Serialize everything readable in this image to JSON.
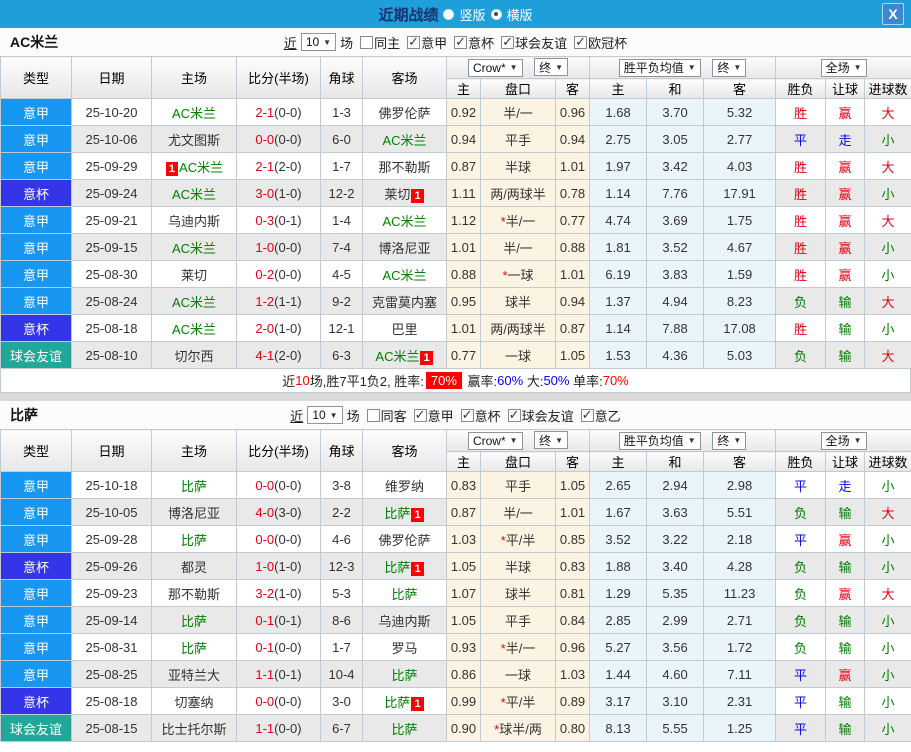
{
  "titlebar": {
    "title": "近期战绩",
    "layout_options": [
      {
        "label": "竖版",
        "selected": false
      },
      {
        "label": "横版",
        "selected": true
      }
    ],
    "close_label": "X"
  },
  "table": {
    "columns": [
      "类型",
      "日期",
      "主场",
      "比分(半场)",
      "角球",
      "客场"
    ],
    "odds_group": {
      "select1": "Crow*",
      "select2": "终",
      "sub": [
        "主",
        "盘口",
        "客"
      ]
    },
    "avg_group": {
      "select1": "胜平负均值",
      "select2": "终",
      "sub": [
        "主",
        "和",
        "客"
      ]
    },
    "result_group": {
      "select1": "全场",
      "sub": [
        "胜负",
        "让球",
        "进球数"
      ]
    }
  },
  "colors": {
    "titlebar_bg": "#1E9FD9",
    "title_text": "#15336E",
    "close_bg": "#3E86D2",
    "focal_team": "#008000",
    "score_red": "#E60012",
    "badge_bg": "#FF0000",
    "stripe": "#E9E9E9",
    "cream": "#FCF4E3",
    "light_blue": "#EAF5FB",
    "border": "#C3CBD2",
    "gap": "#DADADA",
    "stat_blue": "#0000FF",
    "stat_red": "#FF0000",
    "league": {
      "意甲": "#1897F2",
      "意杯": "#3434E8",
      "球会友谊": "#21A89B"
    },
    "result": {
      "胜": "#E60012",
      "平": "#0808E0",
      "负": "#007A00",
      "赢": "#E60012",
      "走": "#0808E0",
      "输": "#007A00",
      "大": "#E60012",
      "小": "#007A00"
    }
  },
  "sections": [
    {
      "team": "AC米兰",
      "filters": {
        "recent_label": "近",
        "count": "10",
        "unit": "场",
        "same_label": "同主",
        "same_checked": false,
        "leagues": [
          {
            "label": "意甲",
            "checked": true
          },
          {
            "label": "意杯",
            "checked": true
          },
          {
            "label": "球会友谊",
            "checked": true
          },
          {
            "label": "欧冠杯",
            "checked": true
          }
        ]
      },
      "rows": [
        {
          "type": "意甲",
          "date": "25-10-20",
          "home": "AC米兰",
          "home_focal": true,
          "home_badge": "",
          "home_badge_pos": "",
          "score": "2-1",
          "half": "(0-0)",
          "corner": "1-3",
          "away": "佛罗伦萨",
          "away_focal": false,
          "away_badge": "",
          "odds_home": "0.92",
          "handicap_star": false,
          "handicap": "半/一",
          "odds_away": "0.96",
          "avg_home": "1.68",
          "avg_draw": "3.70",
          "avg_away": "5.32",
          "res_wdl": "胜",
          "res_handicap": "赢",
          "res_goals": "大"
        },
        {
          "type": "意甲",
          "date": "25-10-06",
          "home": "尤文图斯",
          "home_focal": false,
          "home_badge": "",
          "home_badge_pos": "",
          "score": "0-0",
          "half": "(0-0)",
          "corner": "6-0",
          "away": "AC米兰",
          "away_focal": true,
          "away_badge": "",
          "odds_home": "0.94",
          "handicap_star": false,
          "handicap": "平手",
          "odds_away": "0.94",
          "avg_home": "2.75",
          "avg_draw": "3.05",
          "avg_away": "2.77",
          "res_wdl": "平",
          "res_handicap": "走",
          "res_goals": "小"
        },
        {
          "type": "意甲",
          "date": "25-09-29",
          "home": "AC米兰",
          "home_focal": true,
          "home_badge": "1",
          "home_badge_pos": "left",
          "score": "2-1",
          "half": "(2-0)",
          "corner": "1-7",
          "away": "那不勒斯",
          "away_focal": false,
          "away_badge": "",
          "odds_home": "0.87",
          "handicap_star": false,
          "handicap": "半球",
          "odds_away": "1.01",
          "avg_home": "1.97",
          "avg_draw": "3.42",
          "avg_away": "4.03",
          "res_wdl": "胜",
          "res_handicap": "赢",
          "res_goals": "大"
        },
        {
          "type": "意杯",
          "date": "25-09-24",
          "home": "AC米兰",
          "home_focal": true,
          "home_badge": "",
          "home_badge_pos": "",
          "score": "3-0",
          "half": "(1-0)",
          "corner": "12-2",
          "away": "莱切",
          "away_focal": false,
          "away_badge": "1",
          "odds_home": "1.11",
          "handicap_star": false,
          "handicap": "两/两球半",
          "odds_away": "0.78",
          "avg_home": "1.14",
          "avg_draw": "7.76",
          "avg_away": "17.91",
          "res_wdl": "胜",
          "res_handicap": "赢",
          "res_goals": "小"
        },
        {
          "type": "意甲",
          "date": "25-09-21",
          "home": "乌迪内斯",
          "home_focal": false,
          "home_badge": "",
          "home_badge_pos": "",
          "score": "0-3",
          "half": "(0-1)",
          "corner": "1-4",
          "away": "AC米兰",
          "away_focal": true,
          "away_badge": "",
          "odds_home": "1.12",
          "handicap_star": true,
          "handicap": "半/一",
          "odds_away": "0.77",
          "avg_home": "4.74",
          "avg_draw": "3.69",
          "avg_away": "1.75",
          "res_wdl": "胜",
          "res_handicap": "赢",
          "res_goals": "大"
        },
        {
          "type": "意甲",
          "date": "25-09-15",
          "home": "AC米兰",
          "home_focal": true,
          "home_badge": "",
          "home_badge_pos": "",
          "score": "1-0",
          "half": "(0-0)",
          "corner": "7-4",
          "away": "博洛尼亚",
          "away_focal": false,
          "away_badge": "",
          "odds_home": "1.01",
          "handicap_star": false,
          "handicap": "半/一",
          "odds_away": "0.88",
          "avg_home": "1.81",
          "avg_draw": "3.52",
          "avg_away": "4.67",
          "res_wdl": "胜",
          "res_handicap": "赢",
          "res_goals": "小"
        },
        {
          "type": "意甲",
          "date": "25-08-30",
          "home": "莱切",
          "home_focal": false,
          "home_badge": "",
          "home_badge_pos": "",
          "score": "0-2",
          "half": "(0-0)",
          "corner": "4-5",
          "away": "AC米兰",
          "away_focal": true,
          "away_badge": "",
          "odds_home": "0.88",
          "handicap_star": true,
          "handicap": "一球",
          "odds_away": "1.01",
          "avg_home": "6.19",
          "avg_draw": "3.83",
          "avg_away": "1.59",
          "res_wdl": "胜",
          "res_handicap": "赢",
          "res_goals": "小"
        },
        {
          "type": "意甲",
          "date": "25-08-24",
          "home": "AC米兰",
          "home_focal": true,
          "home_badge": "",
          "home_badge_pos": "",
          "score": "1-2",
          "half": "(1-1)",
          "corner": "9-2",
          "away": "克雷莫内塞",
          "away_focal": false,
          "away_badge": "",
          "odds_home": "0.95",
          "handicap_star": false,
          "handicap": "球半",
          "odds_away": "0.94",
          "avg_home": "1.37",
          "avg_draw": "4.94",
          "avg_away": "8.23",
          "res_wdl": "负",
          "res_handicap": "输",
          "res_goals": "大"
        },
        {
          "type": "意杯",
          "date": "25-08-18",
          "home": "AC米兰",
          "home_focal": true,
          "home_badge": "",
          "home_badge_pos": "",
          "score": "2-0",
          "half": "(1-0)",
          "corner": "12-1",
          "away": "巴里",
          "away_focal": false,
          "away_badge": "",
          "odds_home": "1.01",
          "handicap_star": false,
          "handicap": "两/两球半",
          "odds_away": "0.87",
          "avg_home": "1.14",
          "avg_draw": "7.88",
          "avg_away": "17.08",
          "res_wdl": "胜",
          "res_handicap": "输",
          "res_goals": "小"
        },
        {
          "type": "球会友谊",
          "date": "25-08-10",
          "home": "切尔西",
          "home_focal": false,
          "home_badge": "",
          "home_badge_pos": "",
          "score": "4-1",
          "half": "(2-0)",
          "corner": "6-3",
          "away": "AC米兰",
          "away_focal": true,
          "away_badge": "1",
          "odds_home": "0.77",
          "handicap_star": false,
          "handicap": "一球",
          "odds_away": "1.05",
          "avg_home": "1.53",
          "avg_draw": "4.36",
          "avg_away": "5.03",
          "res_wdl": "负",
          "res_handicap": "输",
          "res_goals": "大"
        }
      ],
      "summary": {
        "prefix": "近",
        "count": "10",
        "middle": "场,胜7平1负2, 胜率:",
        "win_rate": "70%",
        "handicap_label": "赢率:",
        "handicap_rate": "60%",
        "big_label": "大:",
        "big_rate": "50%",
        "single_label": "单率:",
        "single_rate": "70%"
      }
    },
    {
      "team": "比萨",
      "filters": {
        "recent_label": "近",
        "count": "10",
        "unit": "场",
        "same_label": "同客",
        "same_checked": false,
        "leagues": [
          {
            "label": "意甲",
            "checked": true
          },
          {
            "label": "意杯",
            "checked": true
          },
          {
            "label": "球会友谊",
            "checked": true
          },
          {
            "label": "意乙",
            "checked": true
          }
        ]
      },
      "rows": [
        {
          "type": "意甲",
          "date": "25-10-18",
          "home": "比萨",
          "home_focal": true,
          "home_badge": "",
          "home_badge_pos": "",
          "score": "0-0",
          "half": "(0-0)",
          "corner": "3-8",
          "away": "维罗纳",
          "away_focal": false,
          "away_badge": "",
          "odds_home": "0.83",
          "handicap_star": false,
          "handicap": "平手",
          "odds_away": "1.05",
          "avg_home": "2.65",
          "avg_draw": "2.94",
          "avg_away": "2.98",
          "res_wdl": "平",
          "res_handicap": "走",
          "res_goals": "小"
        },
        {
          "type": "意甲",
          "date": "25-10-05",
          "home": "博洛尼亚",
          "home_focal": false,
          "home_badge": "",
          "home_badge_pos": "",
          "score": "4-0",
          "half": "(3-0)",
          "corner": "2-2",
          "away": "比萨",
          "away_focal": true,
          "away_badge": "1",
          "odds_home": "0.87",
          "handicap_star": false,
          "handicap": "半/一",
          "odds_away": "1.01",
          "avg_home": "1.67",
          "avg_draw": "3.63",
          "avg_away": "5.51",
          "res_wdl": "负",
          "res_handicap": "输",
          "res_goals": "大"
        },
        {
          "type": "意甲",
          "date": "25-09-28",
          "home": "比萨",
          "home_focal": true,
          "home_badge": "",
          "home_badge_pos": "",
          "score": "0-0",
          "half": "(0-0)",
          "corner": "4-6",
          "away": "佛罗伦萨",
          "away_focal": false,
          "away_badge": "",
          "odds_home": "1.03",
          "handicap_star": true,
          "handicap": "平/半",
          "odds_away": "0.85",
          "avg_home": "3.52",
          "avg_draw": "3.22",
          "avg_away": "2.18",
          "res_wdl": "平",
          "res_handicap": "赢",
          "res_goals": "小"
        },
        {
          "type": "意杯",
          "date": "25-09-26",
          "home": "都灵",
          "home_focal": false,
          "home_badge": "",
          "home_badge_pos": "",
          "score": "1-0",
          "half": "(1-0)",
          "corner": "12-3",
          "away": "比萨",
          "away_focal": true,
          "away_badge": "1",
          "odds_home": "1.05",
          "handicap_star": false,
          "handicap": "半球",
          "odds_away": "0.83",
          "avg_home": "1.88",
          "avg_draw": "3.40",
          "avg_away": "4.28",
          "res_wdl": "负",
          "res_handicap": "输",
          "res_goals": "小"
        },
        {
          "type": "意甲",
          "date": "25-09-23",
          "home": "那不勒斯",
          "home_focal": false,
          "home_badge": "",
          "home_badge_pos": "",
          "score": "3-2",
          "half": "(1-0)",
          "corner": "5-3",
          "away": "比萨",
          "away_focal": true,
          "away_badge": "",
          "odds_home": "1.07",
          "handicap_star": false,
          "handicap": "球半",
          "odds_away": "0.81",
          "avg_home": "1.29",
          "avg_draw": "5.35",
          "avg_away": "11.23",
          "res_wdl": "负",
          "res_handicap": "赢",
          "res_goals": "大"
        },
        {
          "type": "意甲",
          "date": "25-09-14",
          "home": "比萨",
          "home_focal": true,
          "home_badge": "",
          "home_badge_pos": "",
          "score": "0-1",
          "half": "(0-1)",
          "corner": "8-6",
          "away": "乌迪内斯",
          "away_focal": false,
          "away_badge": "",
          "odds_home": "1.05",
          "handicap_star": false,
          "handicap": "平手",
          "odds_away": "0.84",
          "avg_home": "2.85",
          "avg_draw": "2.99",
          "avg_away": "2.71",
          "res_wdl": "负",
          "res_handicap": "输",
          "res_goals": "小"
        },
        {
          "type": "意甲",
          "date": "25-08-31",
          "home": "比萨",
          "home_focal": true,
          "home_badge": "",
          "home_badge_pos": "",
          "score": "0-1",
          "half": "(0-0)",
          "corner": "1-7",
          "away": "罗马",
          "away_focal": false,
          "away_badge": "",
          "odds_home": "0.93",
          "handicap_star": true,
          "handicap": "半/一",
          "odds_away": "0.96",
          "avg_home": "5.27",
          "avg_draw": "3.56",
          "avg_away": "1.72",
          "res_wdl": "负",
          "res_handicap": "输",
          "res_goals": "小"
        },
        {
          "type": "意甲",
          "date": "25-08-25",
          "home": "亚特兰大",
          "home_focal": false,
          "home_badge": "",
          "home_badge_pos": "",
          "score": "1-1",
          "half": "(0-1)",
          "corner": "10-4",
          "away": "比萨",
          "away_focal": true,
          "away_badge": "",
          "odds_home": "0.86",
          "handicap_star": false,
          "handicap": "一球",
          "odds_away": "1.03",
          "avg_home": "1.44",
          "avg_draw": "4.60",
          "avg_away": "7.11",
          "res_wdl": "平",
          "res_handicap": "赢",
          "res_goals": "小"
        },
        {
          "type": "意杯",
          "date": "25-08-18",
          "home": "切塞纳",
          "home_focal": false,
          "home_badge": "",
          "home_badge_pos": "",
          "score": "0-0",
          "half": "(0-0)",
          "corner": "3-0",
          "away": "比萨",
          "away_focal": true,
          "away_badge": "1",
          "odds_home": "0.99",
          "handicap_star": true,
          "handicap": "平/半",
          "odds_away": "0.89",
          "avg_home": "3.17",
          "avg_draw": "3.10",
          "avg_away": "2.31",
          "res_wdl": "平",
          "res_handicap": "输",
          "res_goals": "小"
        },
        {
          "type": "球会友谊",
          "date": "25-08-15",
          "home": "比士托尔斯",
          "home_focal": false,
          "home_badge": "",
          "home_badge_pos": "",
          "score": "1-1",
          "half": "(0-0)",
          "corner": "6-7",
          "away": "比萨",
          "away_focal": true,
          "away_badge": "",
          "odds_home": "0.90",
          "handicap_star": true,
          "handicap": "球半/两",
          "odds_away": "0.80",
          "avg_home": "8.13",
          "avg_draw": "5.55",
          "avg_away": "1.25",
          "res_wdl": "平",
          "res_handicap": "输",
          "res_goals": "小"
        }
      ]
    }
  ]
}
